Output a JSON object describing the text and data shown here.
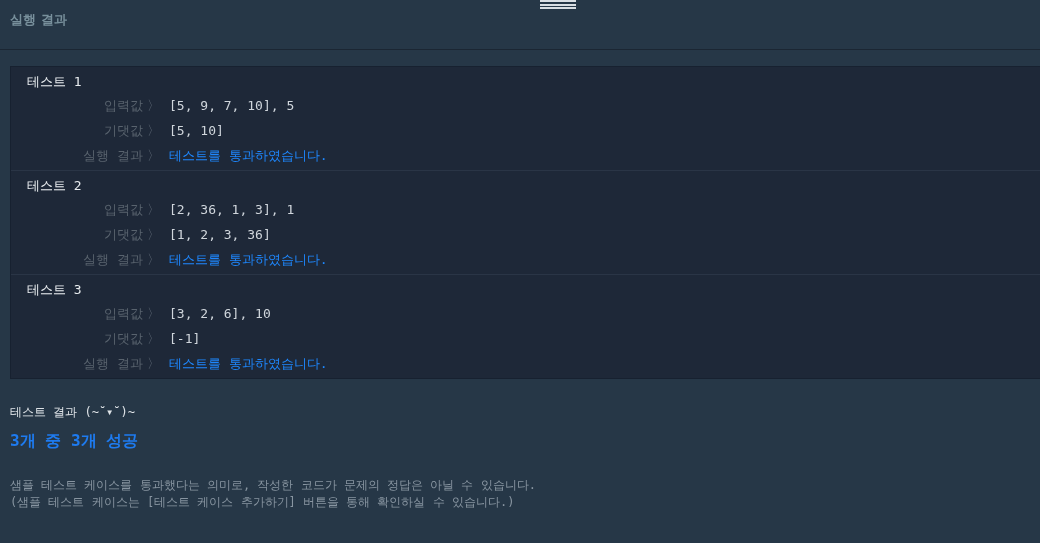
{
  "header": {
    "title": "실행 결과"
  },
  "tests": [
    {
      "title": "테스트 1",
      "rows": [
        {
          "label": "입력값",
          "separator": "〉",
          "value": "[5, 9, 7, 10], 5",
          "kind": "plain"
        },
        {
          "label": "기댓값",
          "separator": "〉",
          "value": "[5, 10]",
          "kind": "plain"
        },
        {
          "label": "실행 결과",
          "separator": "〉",
          "value": "테스트를 통과하였습니다.",
          "kind": "pass"
        }
      ]
    },
    {
      "title": "테스트 2",
      "rows": [
        {
          "label": "입력값",
          "separator": "〉",
          "value": "[2, 36, 1, 3], 1",
          "kind": "plain"
        },
        {
          "label": "기댓값",
          "separator": "〉",
          "value": "[1, 2, 3, 36]",
          "kind": "plain"
        },
        {
          "label": "실행 결과",
          "separator": "〉",
          "value": "테스트를 통과하였습니다.",
          "kind": "pass"
        }
      ]
    },
    {
      "title": "테스트 3",
      "rows": [
        {
          "label": "입력값",
          "separator": "〉",
          "value": "[3, 2, 6], 10",
          "kind": "plain"
        },
        {
          "label": "기댓값",
          "separator": "〉",
          "value": "[-1]",
          "kind": "plain"
        },
        {
          "label": "실행 결과",
          "separator": "〉",
          "value": "테스트를 통과하였습니다.",
          "kind": "pass"
        }
      ]
    }
  ],
  "summary": {
    "heading": "테스트 결과 (~˘▾˘)~",
    "result": "3개 중 3개 성공",
    "notes": [
      "샘플 테스트 케이스를 통과했다는 의미로, 작성한 코드가 문제의 정답은 아닐 수 있습니다.",
      "(샘플 테스트 케이스는 [테스트 케이스 추가하기] 버튼을 통해 확인하실 수 있습니다.)"
    ]
  }
}
